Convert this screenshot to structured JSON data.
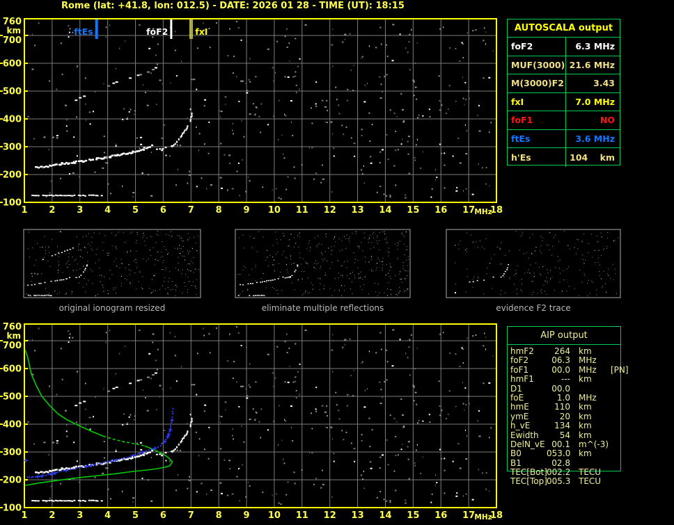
{
  "title": "Rome (lat: +41.8, lon: 012.5) - DATE: 2026 01 28 - TIME (UT): 18:15",
  "colors": {
    "background": "#000000",
    "title": "#ffff4d",
    "axis_label": "#ffff4d",
    "plot_border": "#ffff00",
    "grid": "#7d7d7d",
    "table_border": "#00cc55",
    "autoscala_header": "#ffff00",
    "white": "#ffffff",
    "pale_yellow": "#f0df85",
    "yellow": "#ffff00",
    "red": "#ff1414",
    "blue": "#1177ff",
    "green_profile": "#00cc00",
    "blue_trace": "#2e3cf0",
    "caption": "#b8b8b8",
    "aip_text": "#efef9a",
    "noise_gray": "#909090",
    "noise_dim": "#686868",
    "thumb_border": "#aaaaaa"
  },
  "autoscala_table": {
    "header": "AUTOSCALA output",
    "rows": [
      {
        "label": "foF2",
        "value": "6.3 MHz",
        "color_key": "white"
      },
      {
        "label": "MUF(3000)F2",
        "value": "21.6 MHz",
        "color_key": "pale_yellow"
      },
      {
        "label": "M(3000)F2",
        "value": "3.43",
        "color_key": "pale_yellow"
      },
      {
        "label": "fxI",
        "value": "7.0 MHz",
        "color_key": "yellow"
      },
      {
        "label": "foF1",
        "value": "NO",
        "color_key": "red"
      },
      {
        "label": "ftEs",
        "value": "3.6 MHz",
        "color_key": "blue"
      },
      {
        "label": "h'Es",
        "value": "104    km",
        "color_key": "pale_yellow"
      }
    ]
  },
  "aip_table": {
    "header": "AIP output",
    "rows": [
      {
        "label": "hmF2",
        "value": "264",
        "unit": "km",
        "extra": ""
      },
      {
        "label": "foF2",
        "value": "06.3",
        "unit": "MHz",
        "extra": ""
      },
      {
        "label": "foF1",
        "value": "00.0",
        "unit": "MHz",
        "extra": "[PN]"
      },
      {
        "label": "hmF1",
        "value": "---",
        "unit": "km",
        "extra": ""
      },
      {
        "label": "D1",
        "value": "00.0",
        "unit": "",
        "extra": ""
      },
      {
        "label": "foE",
        "value": "1.0",
        "unit": "MHz",
        "extra": ""
      },
      {
        "label": "hmE",
        "value": "110",
        "unit": "km",
        "extra": ""
      },
      {
        "label": "ymE",
        "value": "20",
        "unit": "km",
        "extra": ""
      },
      {
        "label": "h_vE",
        "value": "134",
        "unit": "km",
        "extra": ""
      },
      {
        "label": "Ewidth",
        "value": "54",
        "unit": "km",
        "extra": ""
      },
      {
        "label": "DelN_vE",
        "value": "00.1",
        "unit": "m^(-3)",
        "extra": ""
      },
      {
        "label": "B0",
        "value": "053.0",
        "unit": "km",
        "extra": ""
      },
      {
        "label": "B1",
        "value": "02.8",
        "unit": "",
        "extra": ""
      },
      {
        "label": "TEC[Bot]",
        "value": "002.2",
        "unit": "TECU",
        "extra": ""
      },
      {
        "label": "TEC[Top]",
        "value": "005.3",
        "unit": "TECU",
        "extra": ""
      }
    ]
  },
  "thumbnails": [
    {
      "caption": "original ionogram resized"
    },
    {
      "caption": "eliminate multiple reflections"
    },
    {
      "caption": "evidence F2 trace"
    }
  ],
  "chart_data": {
    "type": "scatter",
    "xlabel": "MHz",
    "ylabel": "km",
    "xlim": [
      1,
      18
    ],
    "ylim": [
      100,
      760
    ],
    "grid": true,
    "x_ticks": [
      1,
      2,
      3,
      4,
      5,
      6,
      7,
      8,
      9,
      10,
      11,
      12,
      13,
      14,
      15,
      16,
      17,
      18
    ],
    "y_ticks": [
      760,
      700,
      600,
      500,
      400,
      300,
      200,
      100
    ],
    "markers": [
      {
        "label": "ftEs",
        "freq_mhz": 3.6,
        "color_key": "blue"
      },
      {
        "label": "foF2",
        "freq_mhz": 6.3,
        "color_key": "white"
      },
      {
        "label": "fxI",
        "freq_mhz": 7.0,
        "color_key": "yellow"
      }
    ],
    "ionogram_traces": {
      "es_layer": {
        "h_km": 127,
        "f_start": 1.25,
        "f_end": 3.76
      },
      "f_trace": [
        [
          1.38,
          228
        ],
        [
          1.7,
          230
        ],
        [
          2.0,
          235
        ],
        [
          2.4,
          241
        ],
        [
          2.8,
          247
        ],
        [
          3.2,
          253
        ],
        [
          3.6,
          260
        ],
        [
          4.0,
          266
        ],
        [
          4.4,
          273
        ],
        [
          4.8,
          282
        ],
        [
          5.1,
          290
        ],
        [
          5.35,
          298
        ],
        [
          5.55,
          307
        ]
      ],
      "f_trace_upper": [
        [
          5.75,
          295
        ],
        [
          5.95,
          297
        ],
        [
          6.15,
          300
        ],
        [
          6.27,
          304
        ]
      ],
      "faint_row": [
        [
          1.68,
          337
        ],
        [
          2.0,
          336
        ],
        [
          2.3,
          335
        ]
      ],
      "f2_cusp": [
        [
          6.3,
          305
        ],
        [
          6.45,
          320
        ],
        [
          6.6,
          338
        ],
        [
          6.72,
          355
        ],
        [
          6.83,
          372
        ],
        [
          6.92,
          390
        ],
        [
          6.98,
          408
        ],
        [
          7.01,
          424
        ]
      ],
      "second_hop": [
        [
          2.81,
          472
        ],
        [
          3.1,
          486
        ],
        [
          3.4,
          500
        ],
        [
          3.7,
          512
        ],
        [
          4.0,
          523
        ],
        [
          4.3,
          534
        ],
        [
          4.6,
          544
        ],
        [
          4.9,
          553
        ],
        [
          5.15,
          562
        ],
        [
          5.4,
          571
        ],
        [
          5.6,
          579
        ],
        [
          5.7,
          584
        ]
      ]
    },
    "profile_green": [
      [
        1.03,
        667
      ],
      [
        1.12,
        640
      ],
      [
        1.25,
        580
      ],
      [
        1.42,
        540
      ],
      [
        1.63,
        500
      ],
      [
        1.9,
        468
      ],
      [
        2.21,
        437
      ],
      [
        2.55,
        415
      ],
      [
        2.96,
        395
      ],
      [
        3.4,
        375
      ],
      [
        3.84,
        357
      ],
      [
        4.2,
        346
      ],
      [
        4.57,
        337
      ],
      [
        4.95,
        330
      ],
      [
        5.33,
        322
      ],
      [
        5.62,
        310
      ],
      [
        5.9,
        297
      ],
      [
        6.1,
        286
      ],
      [
        6.23,
        275
      ],
      [
        6.33,
        265
      ],
      [
        6.28,
        257
      ],
      [
        6.23,
        250
      ],
      [
        6.05,
        245
      ],
      [
        5.78,
        240
      ],
      [
        5.4,
        235
      ],
      [
        4.9,
        230
      ],
      [
        4.3,
        222
      ],
      [
        3.64,
        215
      ],
      [
        2.9,
        207
      ],
      [
        2.13,
        197
      ],
      [
        1.55,
        189
      ],
      [
        1.03,
        180
      ]
    ],
    "profile_dashed_segment": [
      10,
      14
    ],
    "scaled_trace_blue": [
      [
        1.1,
        208
      ],
      [
        1.4,
        211
      ],
      [
        1.7,
        215
      ],
      [
        2.1,
        225
      ],
      [
        2.5,
        234
      ],
      [
        3.0,
        245
      ],
      [
        3.4,
        252
      ],
      [
        3.8,
        260
      ],
      [
        4.2,
        269
      ],
      [
        4.7,
        280
      ],
      [
        5.0,
        290
      ],
      [
        5.4,
        305
      ],
      [
        5.7,
        314
      ],
      [
        5.9,
        322
      ],
      [
        6.05,
        338
      ],
      [
        6.15,
        355
      ],
      [
        6.23,
        372
      ],
      [
        6.28,
        395
      ],
      [
        6.31,
        415
      ],
      [
        6.33,
        437
      ],
      [
        6.36,
        455
      ]
    ],
    "blue_isolated_point": [
      1.05,
      270
    ],
    "noise": {
      "seed": 987654321,
      "main_plot_dots": 430,
      "thumbnail_dots": [
        320,
        340,
        210
      ]
    }
  }
}
